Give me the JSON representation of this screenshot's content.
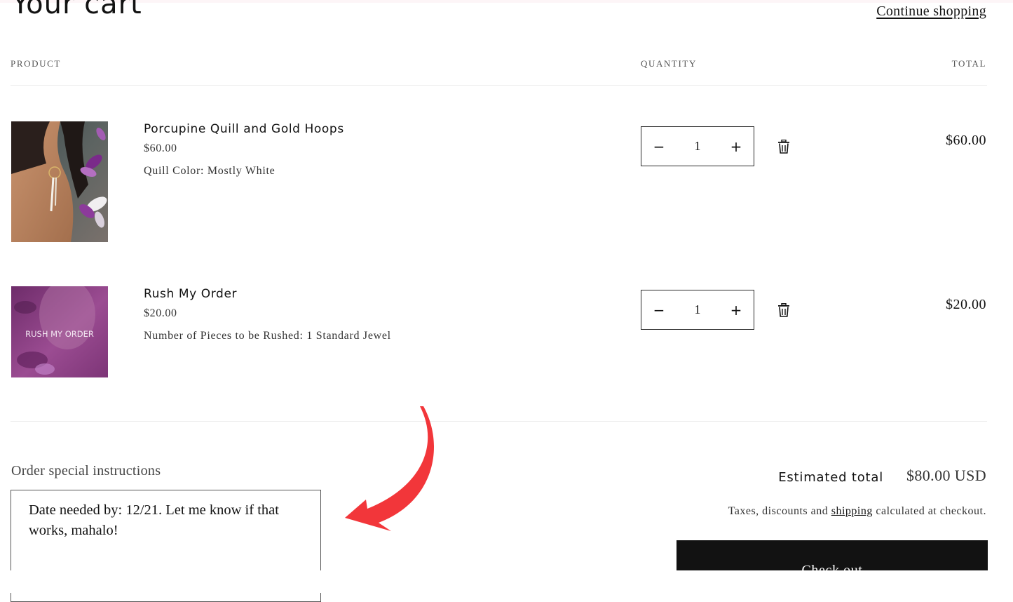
{
  "header": {
    "title": "Your cart",
    "continue_label": "Continue shopping"
  },
  "table": {
    "col_product": "PRODUCT",
    "col_quantity": "QUANTITY",
    "col_total": "TOTAL"
  },
  "items": [
    {
      "name": "Porcupine Quill and Gold Hoops",
      "price": "$60.00",
      "option": "Quill Color: Mostly White",
      "quantity": "1",
      "line_total": "$60.00",
      "image_alt": "earring photo"
    },
    {
      "name": "Rush My Order",
      "price": "$20.00",
      "option": "Number of Pieces to be Rushed: 1 Standard Jewel",
      "quantity": "1",
      "line_total": "$20.00",
      "image_text": "RUSH MY ORDER"
    }
  ],
  "qty_controls": {
    "minus": "−",
    "plus": "+"
  },
  "instructions": {
    "label": "Order special instructions",
    "value": "Date needed by: 12/21. Let me know if that works, mahalo!"
  },
  "summary": {
    "estimated_label": "Estimated total",
    "estimated_value": "$80.00 USD",
    "tax_prefix": "Taxes, discounts and ",
    "tax_link": "shipping",
    "tax_suffix": " calculated at checkout.",
    "checkout_label": "Check out"
  },
  "colors": {
    "accent": "#121212",
    "annotation_arrow": "#f2363a",
    "rush_image_tint": "#8e3b86"
  }
}
